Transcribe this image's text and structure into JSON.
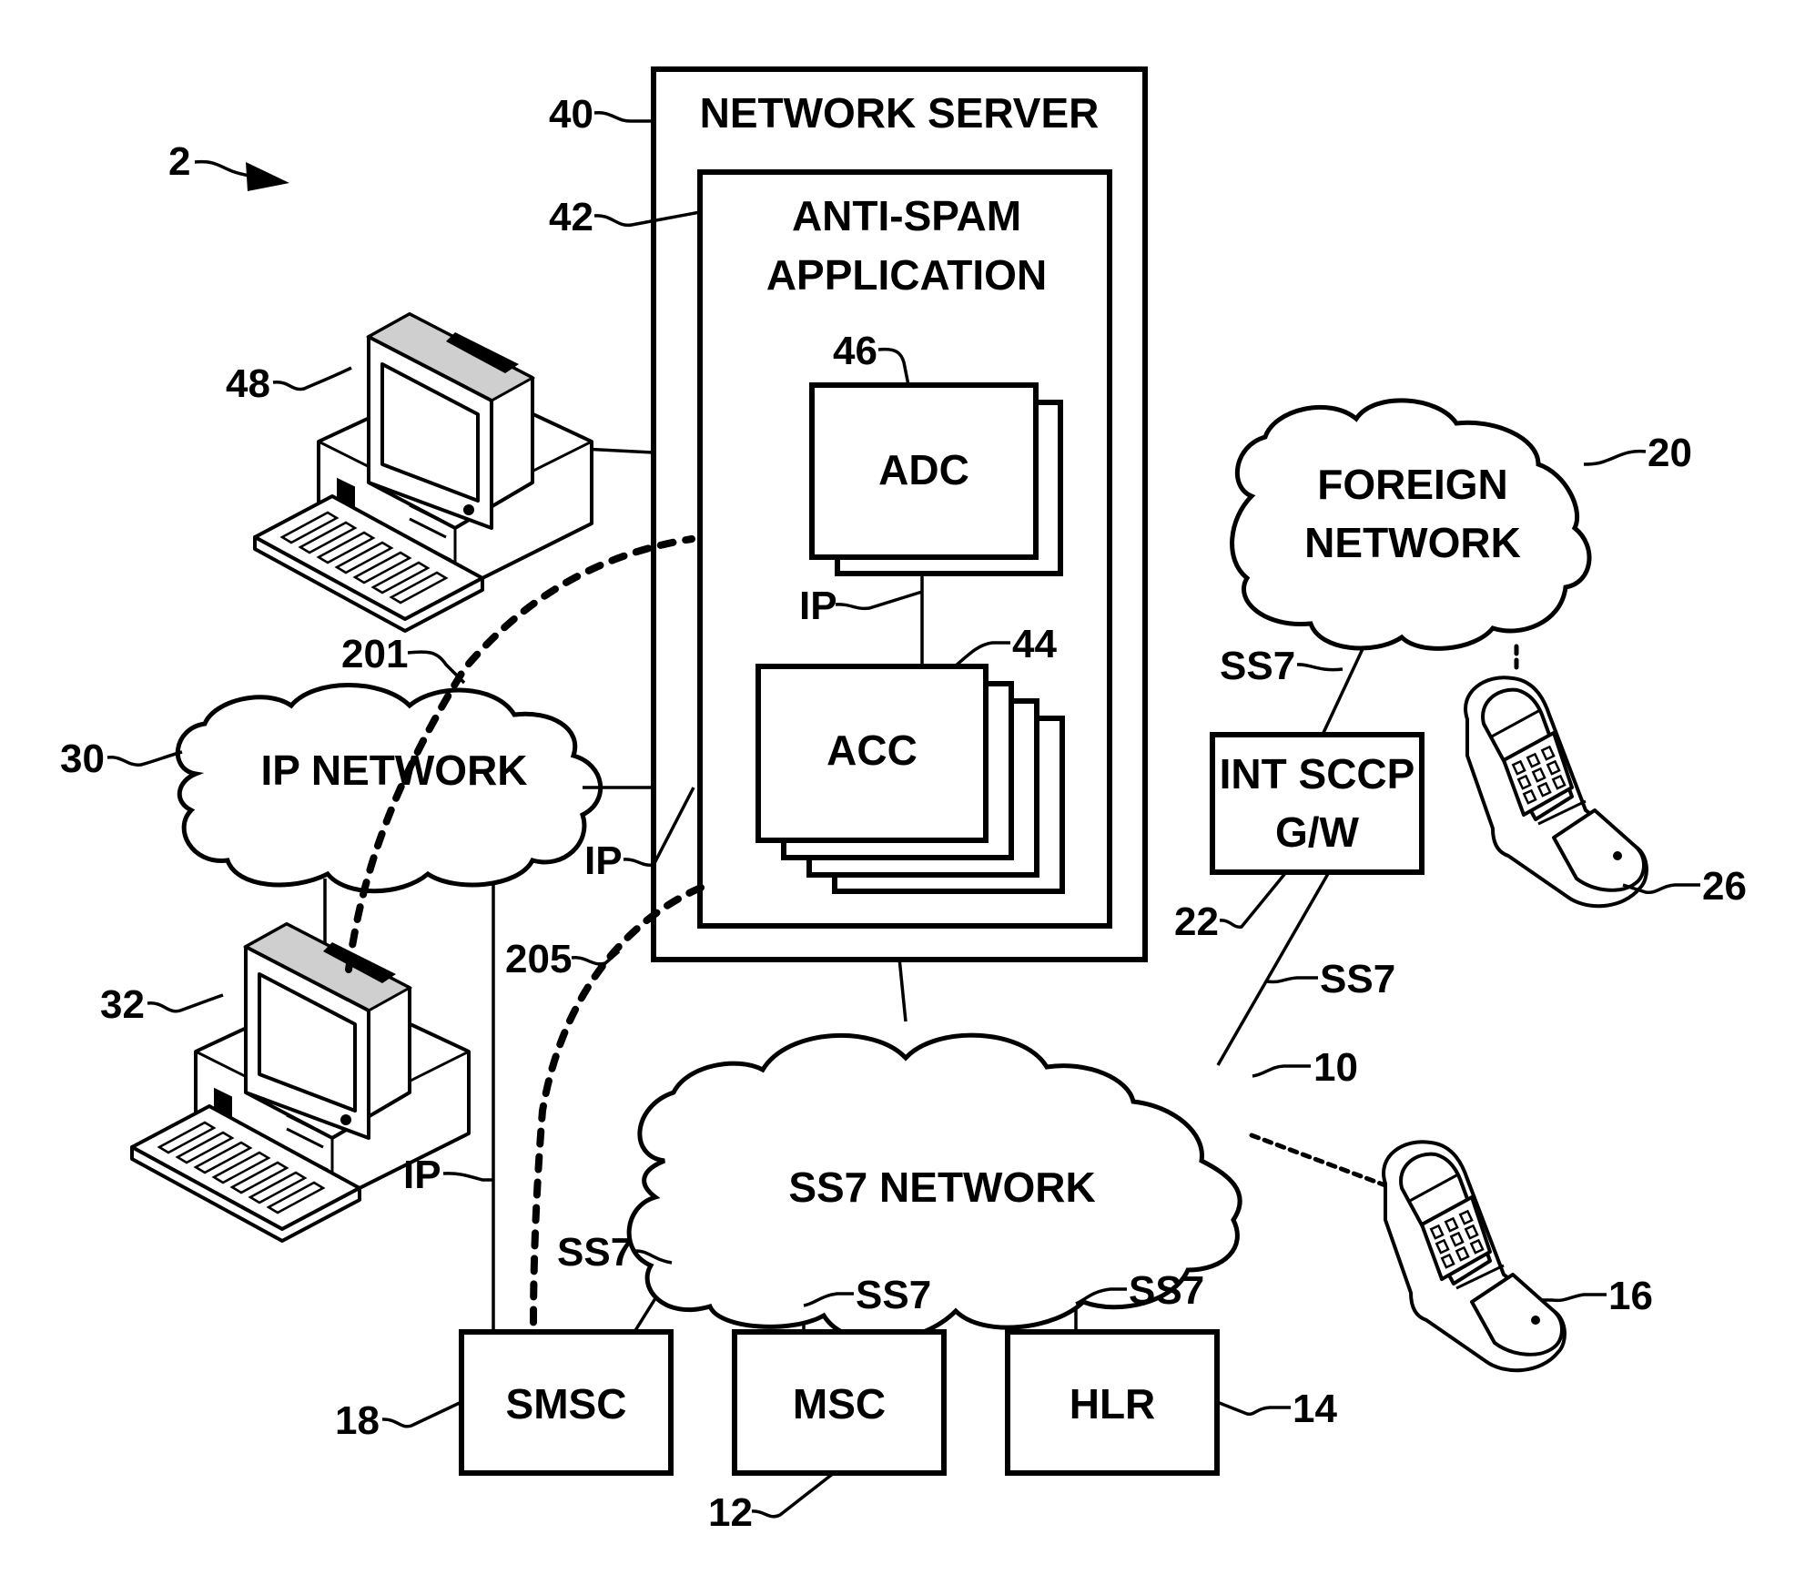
{
  "figure": {
    "reference": "2",
    "colors": {
      "ink": "#000000",
      "paper": "#ffffff"
    }
  },
  "nodes": {
    "network_server": {
      "label": "NETWORK SERVER",
      "ref": "40"
    },
    "anti_spam_application": {
      "label_line1": "ANTI-SPAM",
      "label_line2": "APPLICATION",
      "ref": "42"
    },
    "adc": {
      "label": "ADC",
      "ref": "46"
    },
    "acc": {
      "label": "ACC",
      "ref": "44"
    },
    "ip_network": {
      "label": "IP NETWORK",
      "ref": "30"
    },
    "foreign_network": {
      "label_line1": "FOREIGN",
      "label_line2": "NETWORK",
      "ref": "20"
    },
    "int_sccp_gw": {
      "label_line1": "INT SCCP",
      "label_line2": "G/W",
      "ref": "22"
    },
    "ss7_network": {
      "label": "SS7 NETWORK",
      "ref": "10"
    },
    "smsc": {
      "label": "SMSC",
      "ref": "18"
    },
    "msc": {
      "label": "MSC",
      "ref": "12"
    },
    "hlr": {
      "label": "HLR",
      "ref": "14"
    },
    "computer_admin": {
      "icon": "desktop-computer-icon",
      "ref": "48"
    },
    "computer_user": {
      "icon": "desktop-computer-icon",
      "ref": "32"
    },
    "mobile_foreign": {
      "icon": "mobile-phone-icon",
      "ref": "26"
    },
    "mobile_home": {
      "icon": "mobile-phone-icon",
      "ref": "16"
    }
  },
  "links": {
    "adc_acc": "IP",
    "ip_net_acc": "IP",
    "ip_net_smsc": "IP",
    "foreign_int": "SS7",
    "int_ss7": "SS7",
    "ss7_smsc": "SS7",
    "ss7_msc": "SS7",
    "ss7_hlr": "SS7"
  },
  "flows": {
    "flow_201": "201",
    "flow_205": "205"
  }
}
